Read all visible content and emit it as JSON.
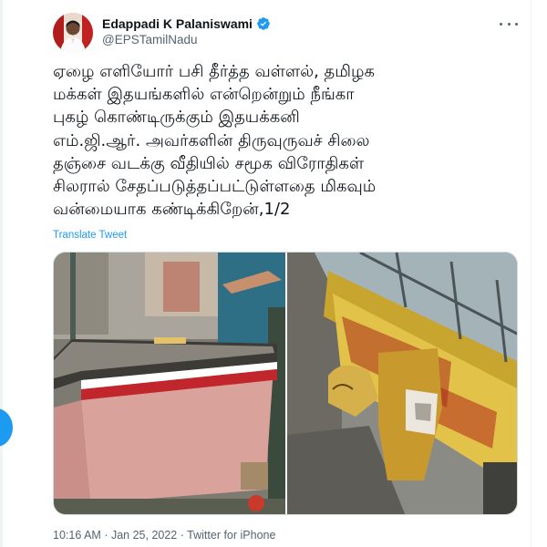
{
  "tweet": {
    "author": {
      "display_name": "Edappadi K Palaniswami",
      "handle": "@EPSTamilNadu",
      "verified": true,
      "avatar_icon": "profile-photo"
    },
    "more_icon": "more-horizontal-icon",
    "text_lines": [
      "ஏழை எளியோர் பசி தீர்த்த வள்ளல், தமிழக",
      "மக்கள் இதயங்களில் என்றென்றும் நீங்கா",
      "புகழ் கொண்டிருக்கும் இதயக்கனி",
      "எம்.ஜி.ஆர். அவர்களின் திருவுருவச் சிலை",
      "தஞ்சை வடக்கு வீதியில் சமூக விரோதிகள்",
      "சிலரால் சேதப்படுத்தப்பட்டுள்ளதை மிகவும்",
      "வன்மையாக கண்டிக்கிறேன்,1/2"
    ],
    "translate_label": "Translate Tweet",
    "meta": {
      "time": "10:16 AM",
      "separator": "·",
      "date": "Jan 25, 2022",
      "source": "Twitter for iPhone"
    }
  },
  "colors": {
    "link": "#1d9bf0",
    "secondary_text": "#536471",
    "primary_text": "#0f1419",
    "border": "#cfd9de"
  }
}
